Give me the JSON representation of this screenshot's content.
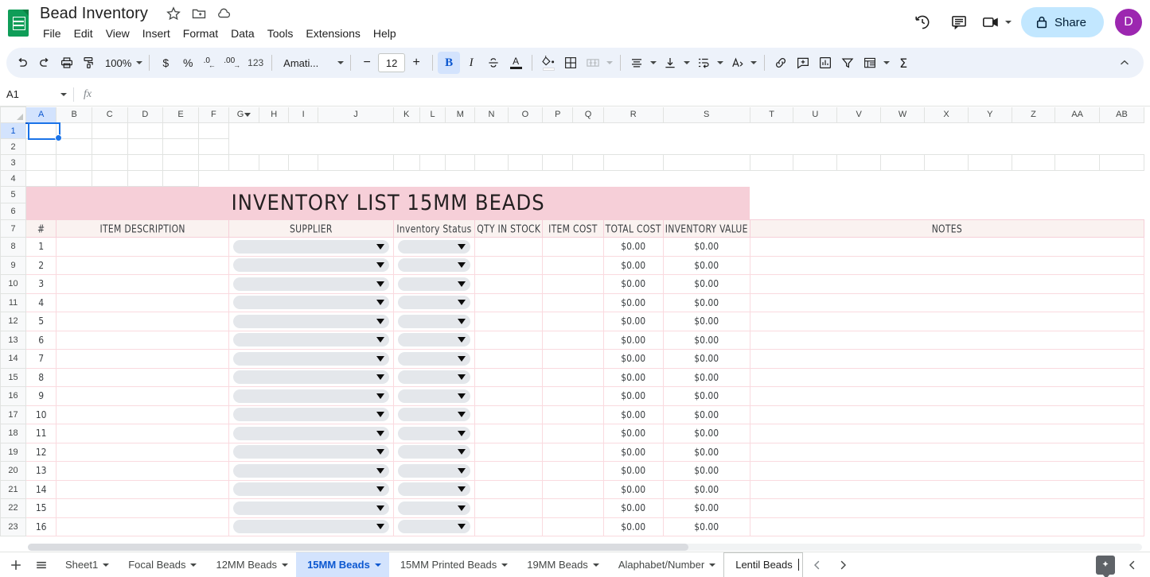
{
  "app": {
    "doc_title": "Bead Inventory",
    "logo_name": "google-sheets-logo"
  },
  "menu": {
    "items": [
      "File",
      "Edit",
      "View",
      "Insert",
      "Format",
      "Data",
      "Tools",
      "Extensions",
      "Help"
    ]
  },
  "header_actions": {
    "history_icon": "version-history-icon",
    "comment_icon": "comment-icon",
    "meet_icon": "meet-video-icon",
    "share_label": "Share",
    "share_lock_icon": "lock-icon",
    "avatar_initial": "D",
    "avatar_color": "#9c27b0",
    "share_bg": "#c2e7ff"
  },
  "toolbar": {
    "undo": "undo-icon",
    "redo": "redo-icon",
    "print": "print-icon",
    "paint_format": "paint-format-icon",
    "zoom_value": "100%",
    "currency": "$",
    "percent": "%",
    "decrease_decimal": ".0",
    "increase_decimal": ".00",
    "more_formats": "123",
    "font_name": "Amati...",
    "font_size": "12",
    "decrease_font": "−",
    "increase_font": "+",
    "bold": "B",
    "italic": "I",
    "strikethrough": "strikethrough-icon",
    "text_color": "A",
    "fill_color": "fill-color-icon",
    "borders": "borders-icon",
    "merge_cells": "merge-cells-icon",
    "horizontal_align": "horizontal-align-icon",
    "vertical_align": "vertical-align-icon",
    "text_wrap": "text-wrapping-icon",
    "text_rotation": "text-rotation-icon",
    "insert_link": "insert-link-icon",
    "insert_comment": "insert-comment-icon",
    "insert_chart": "insert-chart-icon",
    "create_filter": "filter-icon",
    "functions": "Σ",
    "pivot": "pivot-table-icon",
    "collapse": "collapse-toolbar-icon"
  },
  "formula_bar": {
    "name_box": "A1",
    "fx_label": "fx",
    "formula_value": ""
  },
  "grid": {
    "selected_cell": "A1",
    "columns": [
      "A",
      "B",
      "C",
      "D",
      "E",
      "F",
      "G",
      "H",
      "I",
      "J",
      "K",
      "L",
      "M",
      "N",
      "O",
      "P",
      "Q",
      "R",
      "S",
      "T",
      "U",
      "V",
      "W",
      "X",
      "Y",
      "Z",
      "AA",
      "AB"
    ],
    "column_with_filter": "G",
    "row_numbers": [
      1,
      2,
      3,
      4,
      5,
      6,
      7,
      8,
      9,
      10,
      11,
      12,
      13,
      14,
      15,
      16,
      17,
      18,
      19,
      20,
      21,
      22,
      23
    ],
    "banner_title": "INVENTORY LIST 15MM BEADS",
    "banner_color": "#f6cfd8",
    "header_row_color": "#faf2f0",
    "table_headers": [
      "#",
      "ITEM DESCRIPTION",
      "SUPPLIER",
      "Inventory Status",
      "QTY IN STOCK",
      "ITEM COST",
      "TOTAL COST",
      "INVENTORY VALUE",
      "NOTES"
    ],
    "rows": [
      {
        "num": "1",
        "item": "",
        "supplier": "",
        "status": "",
        "qty": "",
        "item_cost": "",
        "total_cost": "$0.00",
        "inventory_value": "$0.00",
        "notes": ""
      },
      {
        "num": "2",
        "item": "",
        "supplier": "",
        "status": "",
        "qty": "",
        "item_cost": "",
        "total_cost": "$0.00",
        "inventory_value": "$0.00",
        "notes": ""
      },
      {
        "num": "3",
        "item": "",
        "supplier": "",
        "status": "",
        "qty": "",
        "item_cost": "",
        "total_cost": "$0.00",
        "inventory_value": "$0.00",
        "notes": ""
      },
      {
        "num": "4",
        "item": "",
        "supplier": "",
        "status": "",
        "qty": "",
        "item_cost": "",
        "total_cost": "$0.00",
        "inventory_value": "$0.00",
        "notes": ""
      },
      {
        "num": "5",
        "item": "",
        "supplier": "",
        "status": "",
        "qty": "",
        "item_cost": "",
        "total_cost": "$0.00",
        "inventory_value": "$0.00",
        "notes": ""
      },
      {
        "num": "6",
        "item": "",
        "supplier": "",
        "status": "",
        "qty": "",
        "item_cost": "",
        "total_cost": "$0.00",
        "inventory_value": "$0.00",
        "notes": ""
      },
      {
        "num": "7",
        "item": "",
        "supplier": "",
        "status": "",
        "qty": "",
        "item_cost": "",
        "total_cost": "$0.00",
        "inventory_value": "$0.00",
        "notes": ""
      },
      {
        "num": "8",
        "item": "",
        "supplier": "",
        "status": "",
        "qty": "",
        "item_cost": "",
        "total_cost": "$0.00",
        "inventory_value": "$0.00",
        "notes": ""
      },
      {
        "num": "9",
        "item": "",
        "supplier": "",
        "status": "",
        "qty": "",
        "item_cost": "",
        "total_cost": "$0.00",
        "inventory_value": "$0.00",
        "notes": ""
      },
      {
        "num": "10",
        "item": "",
        "supplier": "",
        "status": "",
        "qty": "",
        "item_cost": "",
        "total_cost": "$0.00",
        "inventory_value": "$0.00",
        "notes": ""
      },
      {
        "num": "11",
        "item": "",
        "supplier": "",
        "status": "",
        "qty": "",
        "item_cost": "",
        "total_cost": "$0.00",
        "inventory_value": "$0.00",
        "notes": ""
      },
      {
        "num": "12",
        "item": "",
        "supplier": "",
        "status": "",
        "qty": "",
        "item_cost": "",
        "total_cost": "$0.00",
        "inventory_value": "$0.00",
        "notes": ""
      },
      {
        "num": "13",
        "item": "",
        "supplier": "",
        "status": "",
        "qty": "",
        "item_cost": "",
        "total_cost": "$0.00",
        "inventory_value": "$0.00",
        "notes": ""
      },
      {
        "num": "14",
        "item": "",
        "supplier": "",
        "status": "",
        "qty": "",
        "item_cost": "",
        "total_cost": "$0.00",
        "inventory_value": "$0.00",
        "notes": ""
      },
      {
        "num": "15",
        "item": "",
        "supplier": "",
        "status": "",
        "qty": "",
        "item_cost": "",
        "total_cost": "$0.00",
        "inventory_value": "$0.00",
        "notes": ""
      },
      {
        "num": "16",
        "item": "",
        "supplier": "",
        "status": "",
        "qty": "",
        "item_cost": "",
        "total_cost": "$0.00",
        "inventory_value": "$0.00",
        "notes": ""
      }
    ]
  },
  "sheet_tabs": {
    "add_sheet": "add-sheet-icon",
    "all_sheets": "all-sheets-icon",
    "tabs": [
      {
        "label": "Sheet1",
        "active": false,
        "editing": false
      },
      {
        "label": "Focal Beads",
        "active": false,
        "editing": false
      },
      {
        "label": "12MM Beads",
        "active": false,
        "editing": false
      },
      {
        "label": "15MM Beads",
        "active": true,
        "editing": false
      },
      {
        "label": "15MM Printed Beads",
        "active": false,
        "editing": false
      },
      {
        "label": "19MM Beads",
        "active": false,
        "editing": false
      },
      {
        "label": "Alaphabet/Number",
        "active": false,
        "editing": false
      },
      {
        "label": "Lentil Beads",
        "active": false,
        "editing": true
      }
    ],
    "prev_icon": "previous-sheet-icon",
    "next_icon": "next-sheet-icon",
    "explore_icon": "explore-icon",
    "side_panel_icon": "side-panel-toggle-icon"
  }
}
